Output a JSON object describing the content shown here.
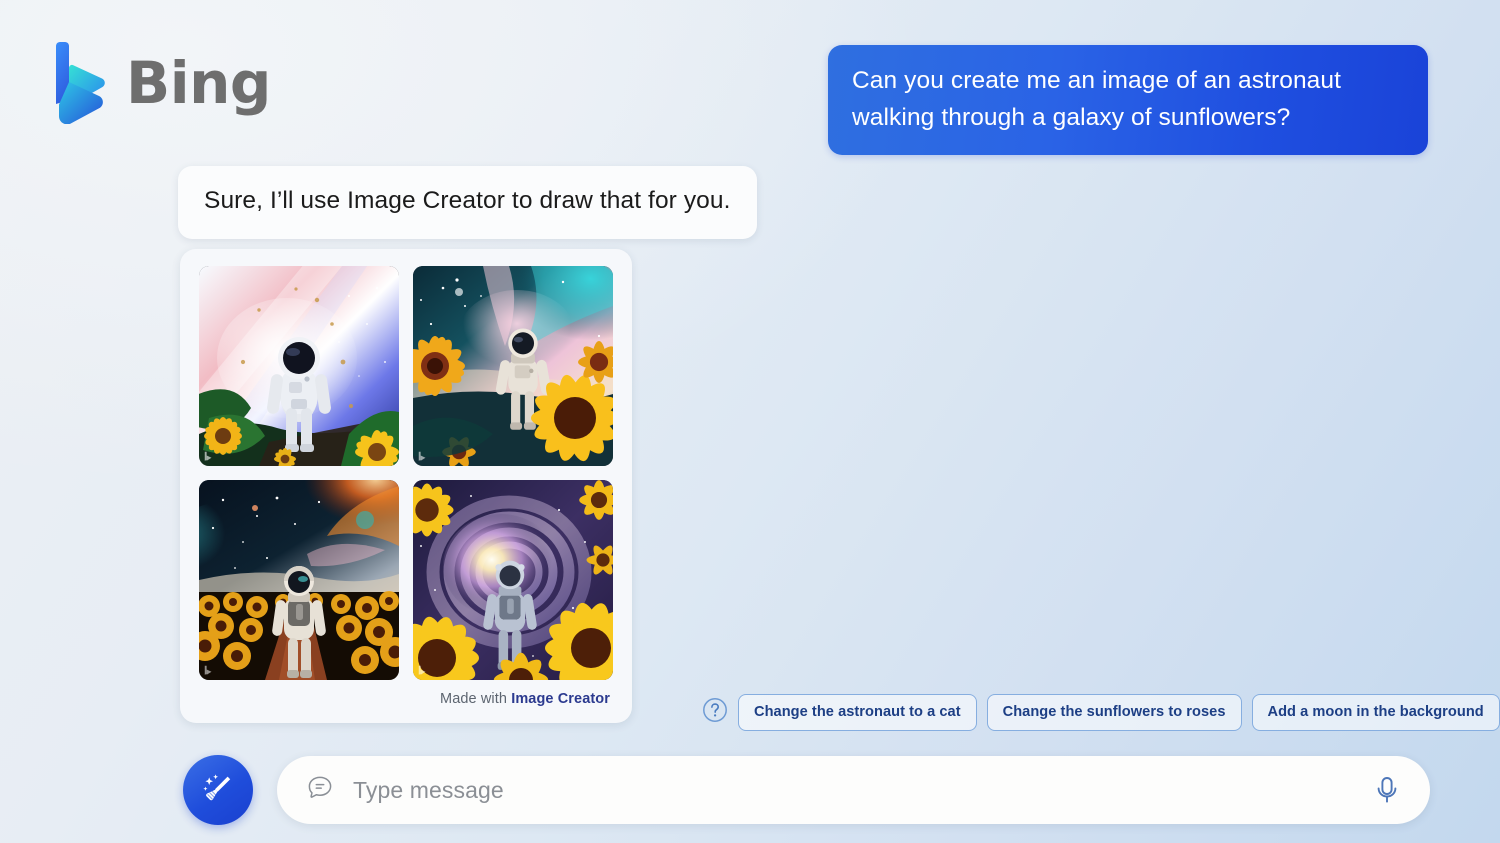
{
  "brand": {
    "name": "Bing",
    "logo_icon": "bing-logo-icon",
    "colors": {
      "logo_start": "#3b7ff0",
      "logo_end": "#32d4d4",
      "text": "#6e6e6e"
    }
  },
  "conversation": {
    "user_message": "Can you create me an image of an astronaut walking through a galaxy of sunflowers?",
    "assistant_message": "Sure, I’ll use Image Creator to draw that for you."
  },
  "results": {
    "attribution_prefix": "Made with",
    "attribution_link": "Image Creator",
    "images": [
      {
        "id": "result-image-1",
        "alt": "Astronaut standing in a bright pastel nebula with sunflowers and leaves in the foreground",
        "palette": {
          "sky_a": "#f6fbff",
          "sky_b": "#f3b9c2",
          "sky_c": "#3d4fd0",
          "ground": "#16351f",
          "flower": "#f2b417"
        }
      },
      {
        "id": "result-image-2",
        "alt": "Astronaut walking through a teal and pink nebula above a field of large sunflowers",
        "palette": {
          "sky_a": "#0f3440",
          "sky_b": "#27c3cf",
          "sky_c": "#f0a7c4",
          "ground": "#123038",
          "flower": "#f7b81a"
        }
      },
      {
        "id": "result-image-3",
        "alt": "Astronaut seen from behind walking a path through a sunflower field under an orange nebula",
        "palette": {
          "sky_a": "#0b1a2a",
          "sky_b": "#e2661f",
          "sky_c": "#2a7f86",
          "ground": "#1b1206",
          "flower": "#f4a81c"
        }
      },
      {
        "id": "result-image-4",
        "alt": "Astronaut walking toward a glowing spiral galaxy framed by giant sunflowers",
        "palette": {
          "sky_a": "#2a2550",
          "sky_b": "#c9a7e8",
          "sky_c": "#fff3d8",
          "ground": "#1a1430",
          "flower": "#f6c41c"
        }
      }
    ]
  },
  "suggestions": {
    "help_icon": "question-circle-icon",
    "chips": [
      "Change the astronaut to a cat",
      "Change the sunflowers to roses",
      "Add a moon in the background"
    ]
  },
  "composer": {
    "new_topic_icon": "broom-sparkle-icon",
    "message_icon": "chat-bubble-icon",
    "placeholder": "Type message",
    "value": "",
    "mic_icon": "microphone-icon"
  },
  "theme": {
    "accent_blue": "#1f4fe0",
    "chip_border": "#86aee0",
    "chip_text": "#1d3f85",
    "background_start": "#eceff3",
    "background_end": "#c3d8ee"
  }
}
